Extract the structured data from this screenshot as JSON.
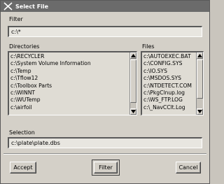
{
  "window": {
    "title": "Select File",
    "icon": "x-window-icon"
  },
  "filter": {
    "label": "Filter",
    "value": "c:\\*"
  },
  "directories": {
    "label": "Directories",
    "items": [
      "c:\\RECYCLER",
      "c:\\System Volume Information",
      "c:\\Temp",
      "c:\\Tflow12",
      "c:\\Toolbox Parts",
      "c:\\WINNT",
      "c:\\WUTemp",
      "c:\\airfoil"
    ]
  },
  "files": {
    "label": "Files",
    "items": [
      "c:\\AUTOEXEC.BAT",
      "c:\\CONFIG.SYS",
      "c:\\IO.SYS",
      "c:\\MSDOS.SYS",
      "c:\\NTDETECT.COM",
      "c:\\PkgClnup.log",
      "c:\\WS_FTP.LOG",
      "c:\\_NavCClt.Log"
    ]
  },
  "selection": {
    "label": "Selection",
    "value": "c:\\plate\\plate.dbs"
  },
  "buttons": {
    "accept": "Accept",
    "filter": "Filter",
    "cancel": "Cancel"
  }
}
